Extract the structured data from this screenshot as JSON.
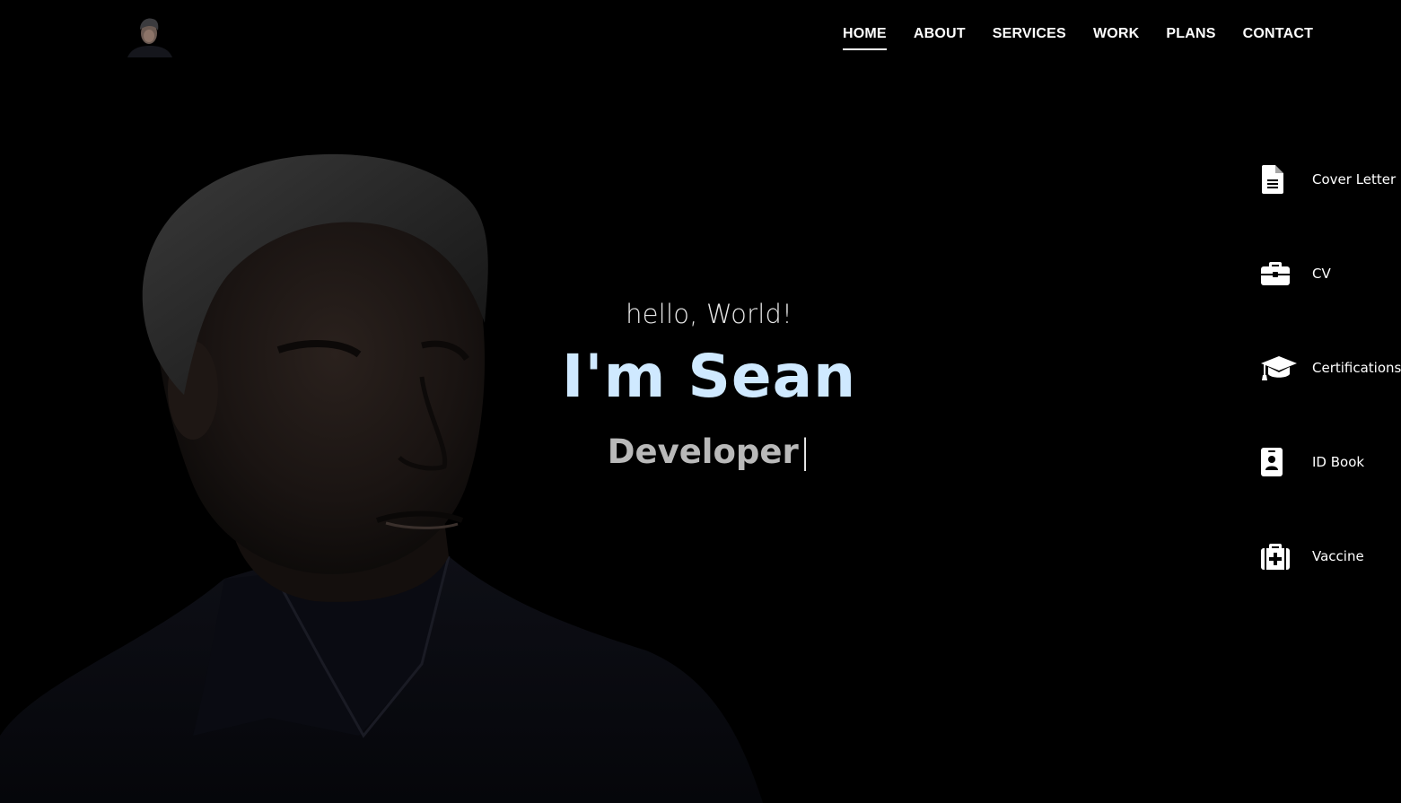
{
  "nav": {
    "items": [
      {
        "label": "HOME",
        "active": true
      },
      {
        "label": "ABOUT",
        "active": false
      },
      {
        "label": "SERVICES",
        "active": false
      },
      {
        "label": "WORK",
        "active": false
      },
      {
        "label": "PLANS",
        "active": false
      },
      {
        "label": "CONTACT",
        "active": false
      }
    ]
  },
  "logo": {
    "icon": "avatar-photo"
  },
  "hero": {
    "greeting": "hello, World!",
    "name": "I'm Sean",
    "role": "Developer",
    "cursor": "|"
  },
  "side_links": [
    {
      "label": "Cover Letter",
      "icon": "document-icon"
    },
    {
      "label": "CV",
      "icon": "briefcase-icon"
    },
    {
      "label": "Certifications",
      "icon": "graduation-cap-icon"
    },
    {
      "label": "ID Book",
      "icon": "id-badge-icon"
    },
    {
      "label": "Vaccine",
      "icon": "medical-kit-icon"
    }
  ],
  "colors": {
    "background": "#000000",
    "name": "#cfe9ff",
    "role": "#b9b9b9",
    "text": "#ffffff"
  }
}
